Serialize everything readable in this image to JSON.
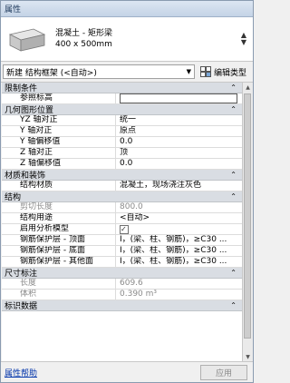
{
  "window": {
    "title": "属性"
  },
  "type_preview": {
    "family": "混凝土 - 矩形梁",
    "type": "400 x 500mm"
  },
  "selector": {
    "value": "新建 结构框架 (<自动>)",
    "edit_type_label": "编辑类型"
  },
  "sections": {
    "constraints": {
      "title": "限制条件",
      "toggle": "⌃"
    },
    "geometry": {
      "title": "几何图形位置",
      "toggle": "⌃"
    },
    "materials": {
      "title": "材质和装饰",
      "toggle": "⌃"
    },
    "structure": {
      "title": "结构",
      "toggle": "⌃"
    },
    "dimensions": {
      "title": "尺寸标注",
      "toggle": "⌃"
    },
    "identity": {
      "title": "标识数据",
      "toggle": "⌃"
    }
  },
  "rows": {
    "ref_level": {
      "k": "参照标高",
      "v": ""
    },
    "yz_justify": {
      "k": "YZ 轴对正",
      "v": "统一"
    },
    "y_justify": {
      "k": "Y 轴对正",
      "v": "原点"
    },
    "y_offset": {
      "k": "Y 轴偏移值",
      "v": "0.0"
    },
    "z_justify": {
      "k": "Z 轴对正",
      "v": "顶"
    },
    "z_offset": {
      "k": "Z 轴偏移值",
      "v": "0.0"
    },
    "struct_material": {
      "k": "结构材质",
      "v": "混凝土，现场浇注灰色"
    },
    "cut_length": {
      "k": "剪切长度",
      "v": "800.0"
    },
    "struct_usage": {
      "k": "结构用途",
      "v": "<自动>"
    },
    "analytical": {
      "k": "启用分析模型",
      "v": true
    },
    "cover_top": {
      "k": "钢筋保护层 - 顶面",
      "v": "I，(梁、柱、钢筋)，≥C30 ..."
    },
    "cover_bottom": {
      "k": "钢筋保护层 - 底面",
      "v": "I，(梁、柱、钢筋)，≥C30 ..."
    },
    "cover_other": {
      "k": "钢筋保护层 - 其他面",
      "v": "I，(梁、柱、钢筋)，≥C30 ..."
    },
    "length": {
      "k": "长度",
      "v": "609.6"
    },
    "volume": {
      "k": "体积",
      "v": "0.390 m³"
    }
  },
  "footer": {
    "help": "属性帮助",
    "apply": "应用"
  },
  "colors": {
    "section_bg": "#d9dde3",
    "link": "#0033aa",
    "title_bg": "#c4d3e6"
  }
}
